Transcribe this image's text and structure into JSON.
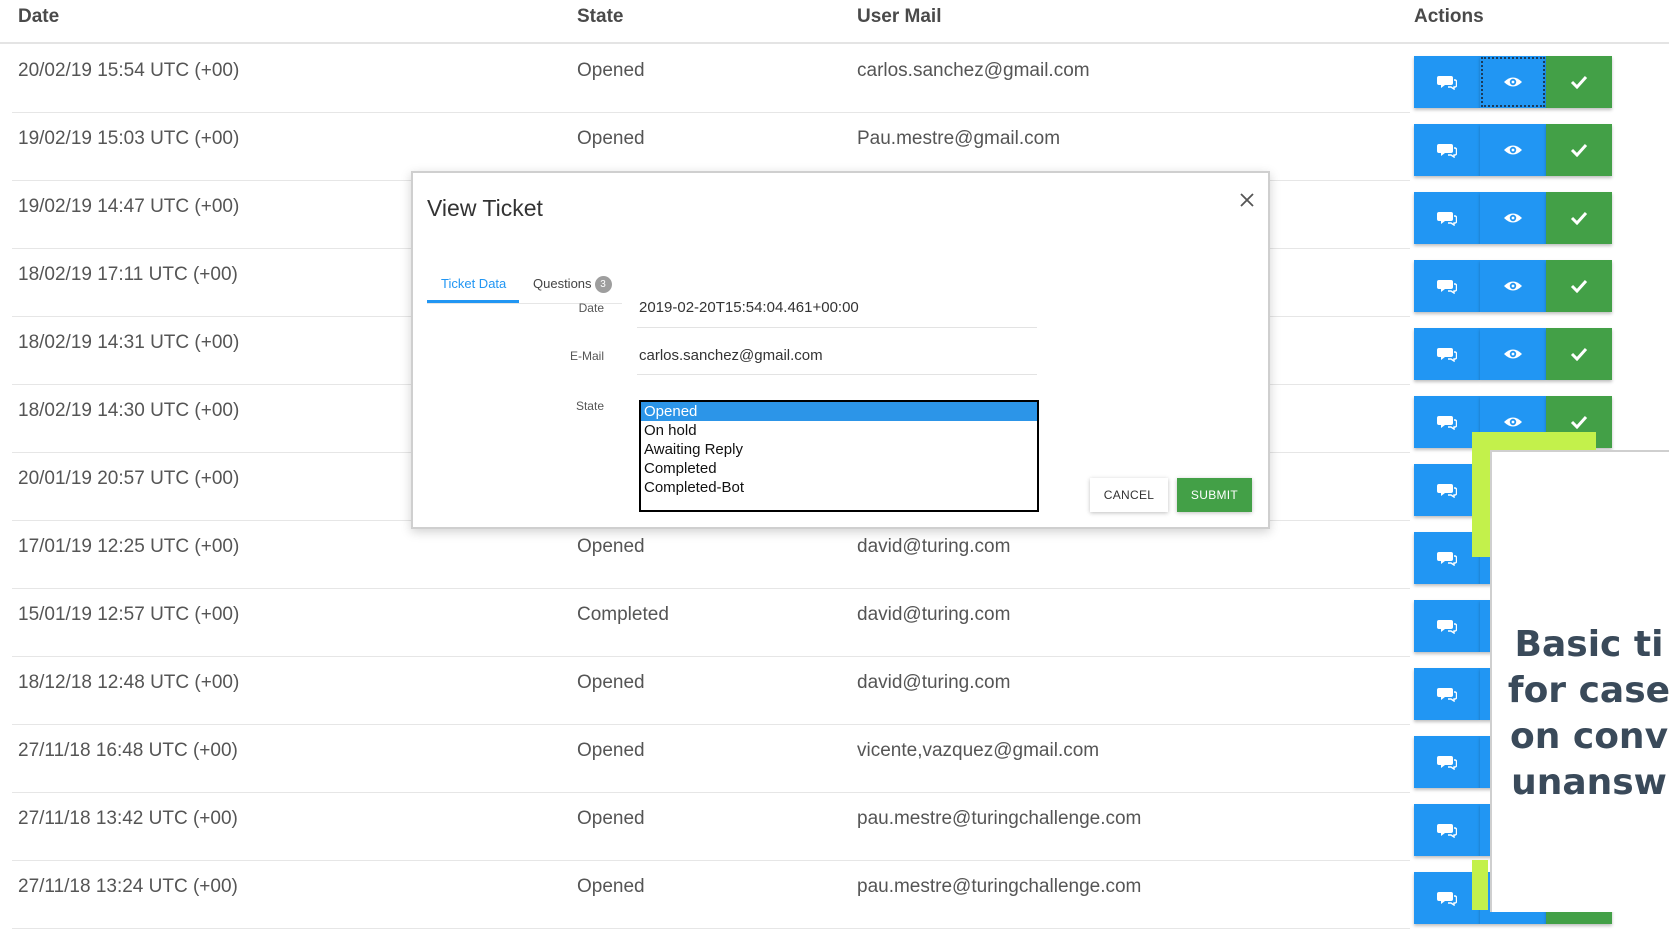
{
  "table": {
    "headers": {
      "date": "Date",
      "state": "State",
      "mail": "User Mail",
      "actions": "Actions"
    },
    "rows": [
      {
        "date": "20/02/19 15:54 UTC (+00)",
        "state": "Opened",
        "mail": "carlos.sanchez@gmail.com"
      },
      {
        "date": "19/02/19 15:03 UTC (+00)",
        "state": "Opened",
        "mail": "Pau.mestre@gmail.com"
      },
      {
        "date": "19/02/19 14:47 UTC (+00)",
        "state": "",
        "mail": ""
      },
      {
        "date": "18/02/19 17:11 UTC (+00)",
        "state": "",
        "mail": ""
      },
      {
        "date": "18/02/19 14:31 UTC (+00)",
        "state": "",
        "mail": ""
      },
      {
        "date": "18/02/19 14:30 UTC (+00)",
        "state": "",
        "mail": ""
      },
      {
        "date": "20/01/19 20:57 UTC (+00)",
        "state": "",
        "mail": ""
      },
      {
        "date": "17/01/19 12:25 UTC (+00)",
        "state": "Opened",
        "mail": "david@turing.com"
      },
      {
        "date": "15/01/19 12:57 UTC (+00)",
        "state": "Completed",
        "mail": "david@turing.com"
      },
      {
        "date": "18/12/18 12:48 UTC (+00)",
        "state": "Opened",
        "mail": "david@turing.com"
      },
      {
        "date": "27/11/18 16:48 UTC (+00)",
        "state": "Opened",
        "mail": "vicente,vazquez@gmail.com"
      },
      {
        "date": "27/11/18 13:42 UTC (+00)",
        "state": "Opened",
        "mail": "pau.mestre@turingchallenge.com"
      },
      {
        "date": "27/11/18 13:24 UTC (+00)",
        "state": "Opened",
        "mail": "pau.mestre@turingchallenge.com"
      }
    ],
    "action_icons": [
      "chat-icon",
      "eye-icon",
      "check-icon"
    ]
  },
  "modal": {
    "title": "View Ticket",
    "tabs": {
      "ticket_data": "Ticket Data",
      "questions": "Questions",
      "questions_count": "3"
    },
    "fields": {
      "date_label": "Date",
      "date_value": "2019-02-20T15:54:04.461+00:00",
      "email_label": "E-Mail",
      "email_value": "carlos.sanchez@gmail.com",
      "state_label": "State"
    },
    "state_options": [
      "Opened",
      "On hold",
      "Awaiting Reply",
      "Completed",
      "Completed-Bot"
    ],
    "selected_state": "Opened",
    "cancel_label": "CANCEL",
    "submit_label": "SUBMIT"
  },
  "overlay": {
    "lines": [
      "Basic ti",
      "for case",
      "on conv",
      "unansw"
    ]
  },
  "colors": {
    "action_blue": "#2196f3",
    "action_green": "#43a047",
    "submit_green": "#43a047",
    "tab_active": "#2196f3",
    "listbox_selected": "#2c95e8",
    "accent_lime": "#c3f14b"
  }
}
